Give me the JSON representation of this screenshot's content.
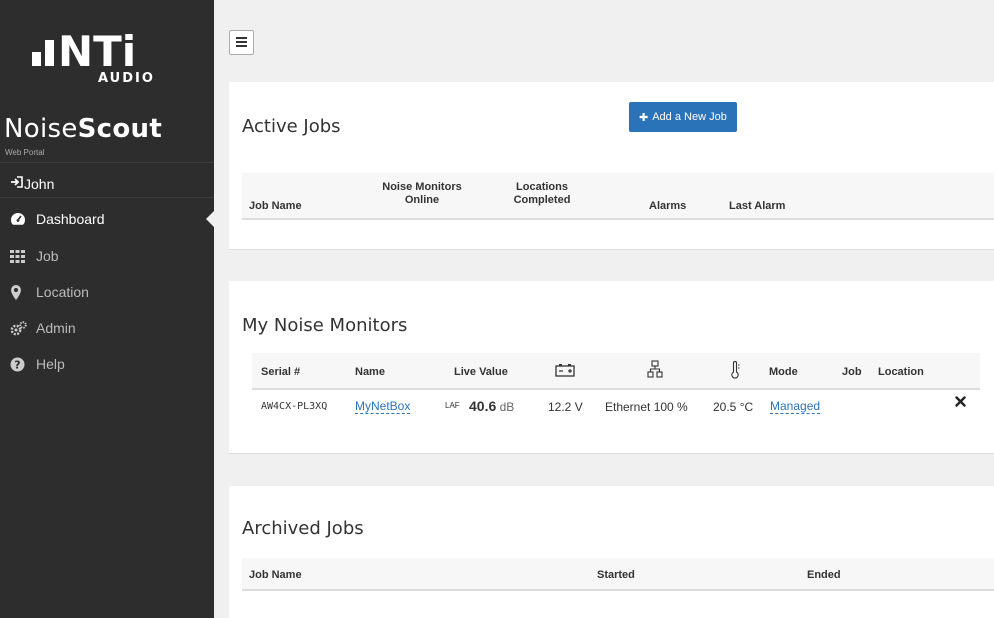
{
  "logo": {
    "brand_letters": "NTi",
    "audio_label": "AUDIO"
  },
  "brand": {
    "prefix": "Noise",
    "suffix": "Scout",
    "subtitle": "Web Portal"
  },
  "user": {
    "name": "John"
  },
  "nav": {
    "items": [
      {
        "label": "Dashboard",
        "icon": "dashboard-icon",
        "active": true
      },
      {
        "label": "Job",
        "icon": "grid-icon"
      },
      {
        "label": "Location",
        "icon": "map-marker-icon"
      },
      {
        "label": "Admin",
        "icon": "cogs-icon"
      },
      {
        "label": "Help",
        "icon": "question-circle-icon"
      }
    ]
  },
  "active_jobs": {
    "title": "Active Jobs",
    "add_button": "Add a New Job",
    "columns": {
      "job_name": "Job Name",
      "noise_monitors_online": [
        "Noise Monitors",
        "Online"
      ],
      "locations_completed": [
        "Locations",
        "Completed"
      ],
      "alarms": "Alarms",
      "last_alarm": "Last Alarm"
    }
  },
  "monitors": {
    "title": "My Noise Monitors",
    "columns": {
      "serial": "Serial #",
      "name": "Name",
      "live_value": "Live Value",
      "battery": "battery-icon",
      "network": "network-icon",
      "temperature": "thermometer-icon",
      "mode": "Mode",
      "job": "Job",
      "location": "Location"
    },
    "rows": [
      {
        "serial": "AW4CX-PL3XQ",
        "name": "MyNetBox",
        "live_weight": "LAF",
        "live_value": "40.6",
        "live_unit": "dB",
        "battery": "12.2 V",
        "network": "Ethernet 100 %",
        "temperature": "20.5 °C",
        "mode": "Managed",
        "remove_icon": "close-icon"
      }
    ]
  },
  "archived_jobs": {
    "title": "Archived Jobs",
    "columns": {
      "job_name": "Job Name",
      "started": "Started",
      "ended": "Ended"
    }
  },
  "colors": {
    "sidebar": "#2d2d2d",
    "accent": "#2a73b8"
  }
}
